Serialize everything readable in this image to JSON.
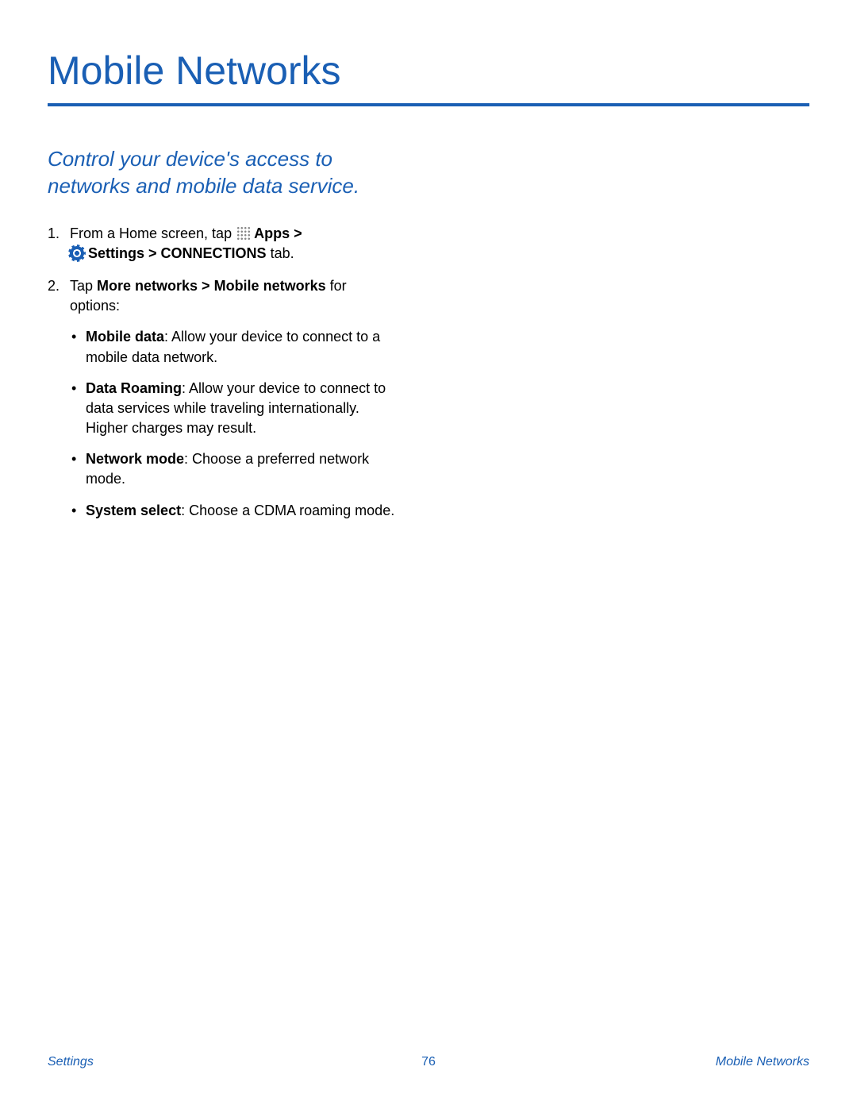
{
  "title": "Mobile Networks",
  "intro": "Control your device's access to networks and mobile data service.",
  "steps": {
    "one": {
      "num": "1.",
      "prefix": "From a Home screen, tap ",
      "apps": "Apps",
      "gt1": " > ",
      "settings": "Settings",
      "gt2": " > ",
      "conn": "CONNECTIONS",
      "tab": " tab."
    },
    "two": {
      "num": "2.",
      "prefix": "Tap ",
      "path": "More networks > Mobile networks",
      "suffix": " for options:"
    }
  },
  "bullets": [
    {
      "label": "Mobile data",
      "text": ": Allow your device to connect to a mobile data network."
    },
    {
      "label": "Data Roaming",
      "text": ": Allow your device to connect to data services while traveling internationally. Higher charges may result."
    },
    {
      "label": "Network mode",
      "text": ": Choose a preferred network mode."
    },
    {
      "label": "System select",
      "text": ": Choose a CDMA roaming mode."
    }
  ],
  "footer": {
    "left": "Settings",
    "center": "76",
    "right": "Mobile Networks"
  }
}
